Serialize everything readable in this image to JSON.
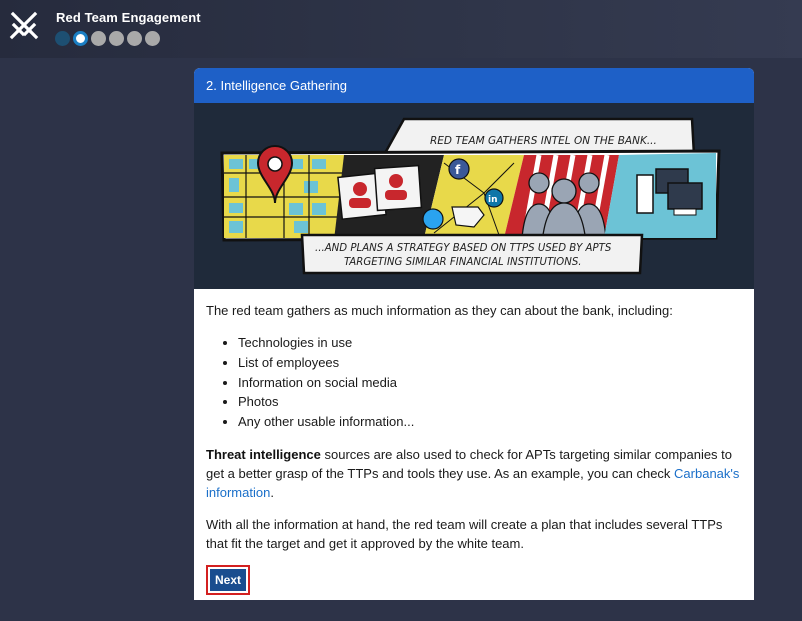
{
  "app": {
    "title": "Red Team Engagement",
    "progress": {
      "total_steps": 6,
      "current_step": 2,
      "colors": {
        "done": "#1d4f72",
        "current": "#1b7fc4",
        "todo": "#a9a9a9"
      }
    },
    "icon": "crossed-swords-icon"
  },
  "card": {
    "header": "2. Intelligence Gathering",
    "banner": {
      "caption_top": "RED TEAM GATHERS INTEL ON THE BANK...",
      "caption_bottom_line1": "...AND PLANS A STRATEGY BASED ON TTPS USED BY APTS",
      "caption_bottom_line2": "TARGETING SIMILAR FINANCIAL INSTITUTIONS."
    },
    "intro": "The red team gathers as much information as they can about the bank, including:",
    "list": [
      "Technologies in use",
      "List of employees",
      "Information on social media",
      "Photos",
      "Any other usable information..."
    ],
    "threat": {
      "bold": "Threat intelligence",
      "text": " sources are also used to check for APTs targeting similar companies to get a better grasp of the TTPs and tools they use. As an example, you can check ",
      "link": "Carbanak's information",
      "end": "."
    },
    "plan": "With all the information at hand, the red team will create a plan that includes several TTPs that fit the target and get it approved by the white team.",
    "next_label": "Next"
  },
  "colors": {
    "background": "#2d3348",
    "header_blue": "#1e60c7",
    "button_blue": "#1a4d8f",
    "link": "#1a6fc9",
    "highlight_red": "#d32020"
  }
}
